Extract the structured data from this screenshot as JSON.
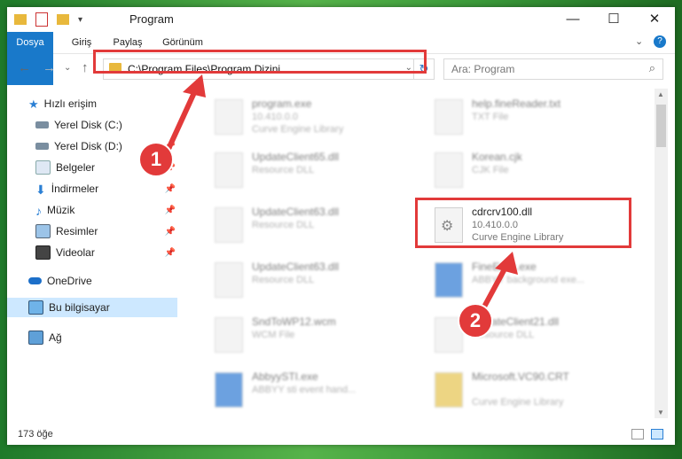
{
  "window": {
    "title": "Program"
  },
  "ribbon": {
    "tabs": [
      "Dosya",
      "Giriş",
      "Paylaş",
      "Görünüm"
    ]
  },
  "address": {
    "path": "C:\\Program Files\\Program Dizini"
  },
  "search": {
    "placeholder": "Ara: Program"
  },
  "sidebar": {
    "items": [
      {
        "label": "Hızlı erişim",
        "icon": "star-icon"
      },
      {
        "label": "Yerel Disk (C:)",
        "icon": "drive-icon"
      },
      {
        "label": "Yerel Disk (D:)",
        "icon": "drive-icon"
      },
      {
        "label": "Belgeler",
        "icon": "documents-icon"
      },
      {
        "label": "İndirmeler",
        "icon": "download-icon"
      },
      {
        "label": "Müzik",
        "icon": "music-icon"
      },
      {
        "label": "Resimler",
        "icon": "pictures-icon"
      },
      {
        "label": "Videolar",
        "icon": "video-icon"
      },
      {
        "label": "OneDrive",
        "icon": "cloud-icon"
      },
      {
        "label": "Bu bilgisayar",
        "icon": "computer-icon"
      },
      {
        "label": "Ağ",
        "icon": "network-icon"
      }
    ]
  },
  "files": [
    {
      "name": "program.exe",
      "sub1": "10.410.0.0",
      "sub2": "Curve Engine Library"
    },
    {
      "name": "help.fineReader.txt",
      "sub1": "TXT File",
      "sub2": ""
    },
    {
      "name": "UpdateClient65.dll",
      "sub1": "Resource DLL",
      "sub2": ""
    },
    {
      "name": "Korean.cjk",
      "sub1": "CJK File",
      "sub2": ""
    },
    {
      "name": "UpdateClient63.dll",
      "sub1": "Resource DLL",
      "sub2": ""
    },
    {
      "name": "cdrcrv100.dll",
      "sub1": "10.410.0.0",
      "sub2": "Curve Engine Library"
    },
    {
      "name": "UpdateClient63.dll",
      "sub1": "Resource DLL",
      "sub2": ""
    },
    {
      "name": "FineExec.exe",
      "sub1": "ABBYY background exe...",
      "sub2": ""
    },
    {
      "name": "SndToWP12.wcm",
      "sub1": "WCM File",
      "sub2": ""
    },
    {
      "name": "UpdateClient21.dll",
      "sub1": "Resource DLL",
      "sub2": ""
    },
    {
      "name": "AbbyySTI.exe",
      "sub1": "ABBYY sti event hand...",
      "sub2": ""
    },
    {
      "name": "Microsoft.VC90.CRT",
      "sub1": "",
      "sub2": "Curve Engine Library"
    }
  ],
  "status": {
    "count": "173 öğe"
  },
  "badges": [
    "1",
    "2"
  ],
  "colors": {
    "accent": "#1979ca",
    "highlight": "#e23a3a"
  }
}
